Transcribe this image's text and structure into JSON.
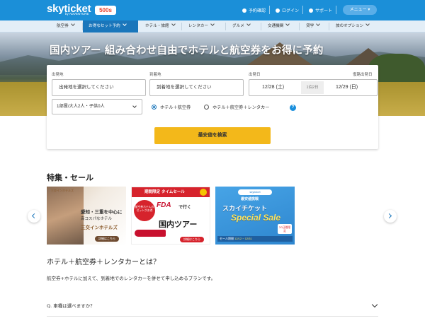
{
  "header": {
    "logo": "skyticket",
    "logo_sub": "by ADVENTURE",
    "badge": "500s",
    "links": [
      {
        "label": "予約確認",
        "icon": "document-icon"
      },
      {
        "label": "ログイン",
        "icon": "user-icon"
      },
      {
        "label": "サポート",
        "icon": "help-icon"
      }
    ],
    "menu_label": "メニュー"
  },
  "nav": {
    "items": [
      {
        "label": "航空券",
        "active": false
      },
      {
        "label": "お得なセット予約",
        "active": true
      },
      {
        "label": "ホテル・旅館",
        "active": false
      },
      {
        "label": "レンタカー",
        "active": false
      },
      {
        "label": "グルメ",
        "active": false
      },
      {
        "label": "交通機関",
        "active": false
      },
      {
        "label": "貸学",
        "active": false
      },
      {
        "label": "旅のオプション",
        "active": false
      }
    ]
  },
  "hero": {
    "title": "国内ツアー 組み合わせ自由でホテルと航空券をお得に予約"
  },
  "search": {
    "departure_label": "出発地",
    "departure_placeholder": "出発地を選択してください",
    "arrival_label": "到着地",
    "arrival_placeholder": "到着地を選択してください",
    "checkin_label": "出発日",
    "checkout_label": "復路出発日",
    "checkin_date": "12/28 (土)",
    "nights": "1泊2日",
    "checkout_date": "12/29 (日)",
    "guests": "1部屋/大人2人・子供0人",
    "option_hotel_air": "ホテル＋航空券",
    "option_hotel_air_car": "ホテル＋航空券＋レンタカー",
    "help": "?",
    "button_label": "最安値を検索"
  },
  "sale": {
    "title": "特集・セール",
    "banners": [
      {
        "brand": "三交インホテルズ",
        "line1": "愛知・三重を中心に",
        "line2": "高コスパなホテル",
        "line3": "三交インホテルズ",
        "more": "詳細はこちら"
      },
      {
        "top": "期間限定 タイムセール",
        "circle": "航空券ホテルのセットがお得",
        "brand": "FDA",
        "brand_tail": "で行く",
        "tour": "国内ツアー",
        "more": "詳細はこちら"
      },
      {
        "tag": "skyticket",
        "cheap": "最安値挑戦",
        "line1": "スカイチケット",
        "line2": "Special Sale",
        "days": "20日間限定",
        "period_label": "セール期間",
        "period": "12/12 ~ 12/31"
      }
    ]
  },
  "faq": {
    "title": "ホテル＋航空券＋レンタカーとは？",
    "desc": "航空券+ホテルに加えて、到着地でのレンタカーを併せて申し込めるプランです。",
    "question": "Q. 車種は選べますか？"
  },
  "colors": {
    "header": "#1b8fd8",
    "nav_active": "#1a76bb",
    "search_button": "#f3b81a"
  }
}
